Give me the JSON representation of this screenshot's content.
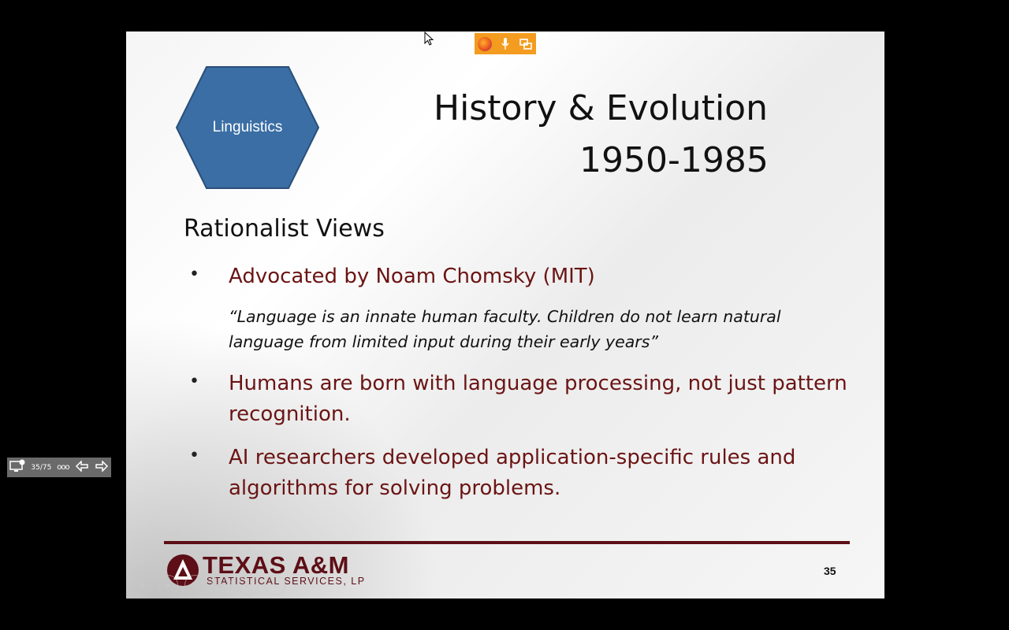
{
  "slide": {
    "shape_label": "Linguistics",
    "title_line1": "History & Evolution",
    "title_line2": "1950-1985",
    "heading": "Rationalist Views",
    "bullets": [
      {
        "text": "Advocated by Noam Chomsky (MIT)"
      },
      {
        "text": "Humans are born with language processing, not just pattern recognition."
      },
      {
        "text": "AI researchers developed application-specific rules and algorithms for solving problems."
      }
    ],
    "quote": "“Language is an innate human faculty.  Children do not learn natural language from limited input during their early years”",
    "bullet_char": "•",
    "logo_main": "TEXAS A&M",
    "logo_sub": "STATISTICAL SERVICES, LP",
    "page_number": "35"
  },
  "presenter_toolbar": {
    "slide_counter": "35/75",
    "more": "ooo"
  },
  "icons": {
    "hex_color": "#3a6ea5",
    "accent": "#6b1414",
    "ext_bar_color": "#f39c1f"
  }
}
